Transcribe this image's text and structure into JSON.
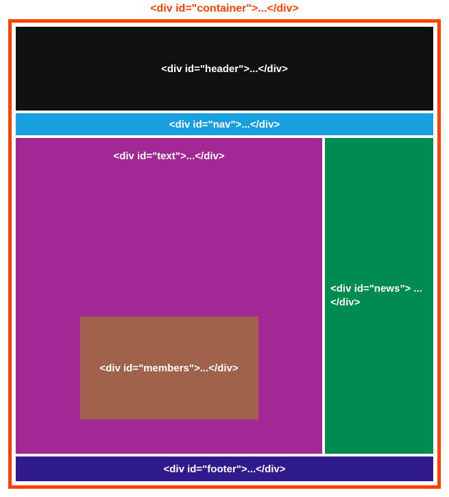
{
  "container": {
    "label": "<div id=\"container\">...</div>"
  },
  "header": {
    "label": "<div id=\"header\">...</div>"
  },
  "nav": {
    "label": "<div id=\"nav\">...</div>"
  },
  "text": {
    "label": "<div id=\"text\">...</div>"
  },
  "members": {
    "label": "<div id=\"members\">...</div>"
  },
  "news": {
    "label": "<div id=\"news\"> ...</div>"
  },
  "footer": {
    "label": "<div id=\"footer\">...</div>"
  },
  "colors": {
    "border": "#ff4000",
    "header_bg": "#111111",
    "nav_bg": "#179fe0",
    "text_bg": "#a22896",
    "members_bg": "#a1624b",
    "news_bg": "#008b51",
    "footer_bg": "#301b8c",
    "label_fg": "#ffffff"
  }
}
